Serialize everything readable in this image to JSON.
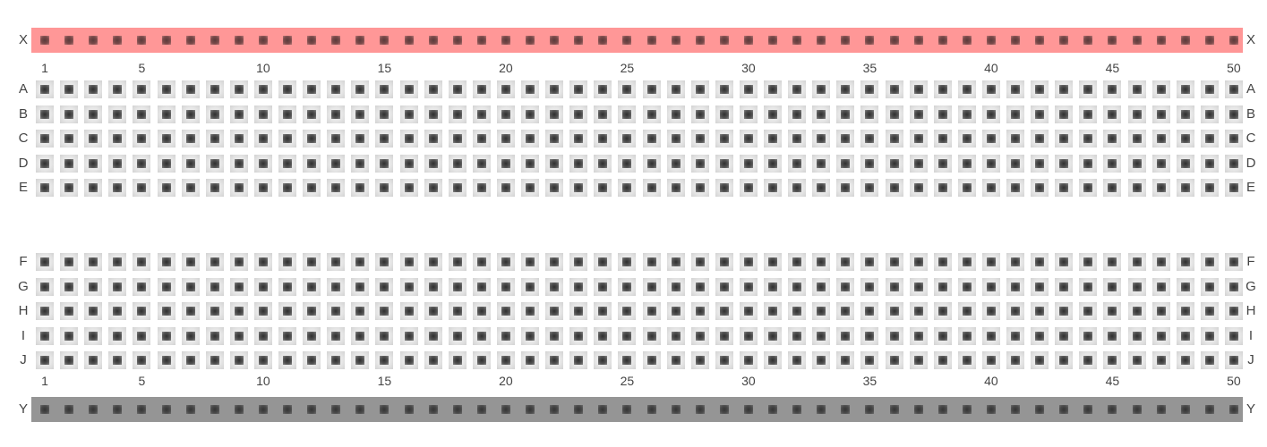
{
  "rails": {
    "top": {
      "label": "X",
      "color": "#ff9797"
    },
    "bottom": {
      "label": "Y",
      "color": "#959595"
    }
  },
  "column_numbers": [
    "1",
    "5",
    "10",
    "15",
    "20",
    "25",
    "30",
    "35",
    "40",
    "45",
    "50"
  ],
  "column_count": 50,
  "upper_rows": [
    "A",
    "B",
    "C",
    "D",
    "E"
  ],
  "lower_rows": [
    "F",
    "G",
    "H",
    "I",
    "J"
  ]
}
